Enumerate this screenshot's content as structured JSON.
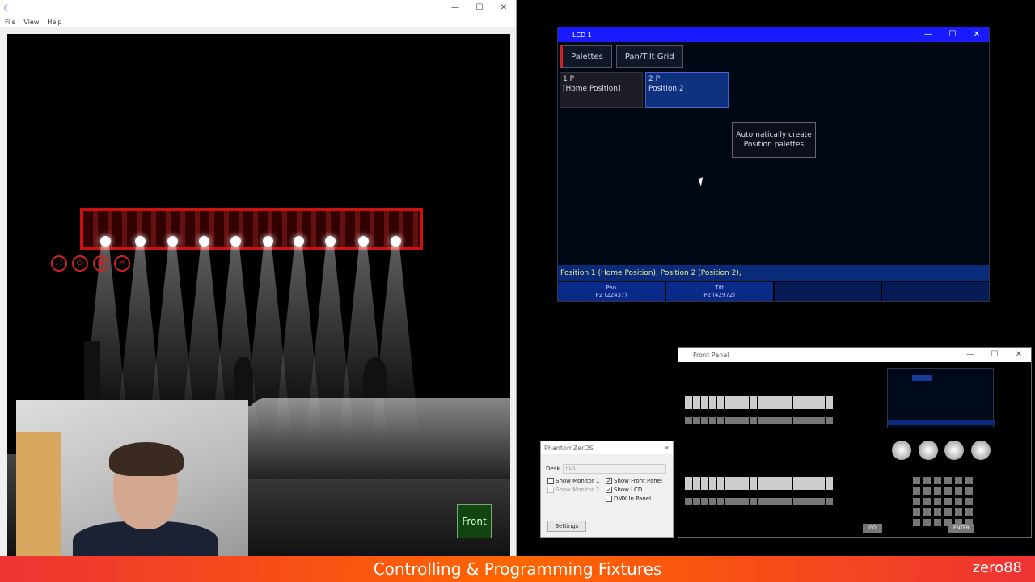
{
  "visualiser": {
    "menu": [
      "File",
      "View",
      "Help"
    ],
    "window_controls": [
      "—",
      "☐",
      "✕"
    ],
    "front_button": "Front"
  },
  "lcd": {
    "title": "LCD 1",
    "window_controls": [
      "—",
      "☐",
      "✕"
    ],
    "tabs": [
      "Palettes",
      "Pan/Tilt Grid"
    ],
    "palettes": [
      {
        "num": "1 P",
        "name": "[Home Position]"
      },
      {
        "num": "2 P",
        "name": "Position 2"
      }
    ],
    "auto_button": "Automatically create Position palettes",
    "status": "Position 1 (Home Position), Position 2 (Position 2),",
    "attributes": [
      {
        "name": "Pan",
        "value": "P2 (22437)"
      },
      {
        "name": "Tilt",
        "value": "P2 (42972)"
      },
      {
        "name": "",
        "value": ""
      },
      {
        "name": "",
        "value": ""
      }
    ]
  },
  "phantom": {
    "title": "PhantomZerOS",
    "desk_label": "Desk",
    "desk_value": "FLX",
    "options": [
      {
        "label": "Show Monitor 1",
        "checked": false,
        "enabled": true
      },
      {
        "label": "Show Monitor 2",
        "checked": false,
        "enabled": false
      },
      {
        "label": "Show Front Panel",
        "checked": true,
        "enabled": true
      },
      {
        "label": "Show LCD",
        "checked": true,
        "enabled": true
      },
      {
        "label": "DMX In Panel",
        "checked": false,
        "enabled": true
      }
    ],
    "settings_button": "Settings"
  },
  "front_panel": {
    "title": "Front Panel",
    "window_controls": [
      "—",
      "☐",
      "✕"
    ],
    "go_button": "GO",
    "enter_button": "ENTER"
  },
  "banner": {
    "title": "Controlling & Programming Fixtures",
    "logo": "zero88"
  },
  "colors": {
    "accent_orange": "#f60",
    "lcd_blue": "#1a1aff",
    "truss_red": "#cc1111"
  }
}
